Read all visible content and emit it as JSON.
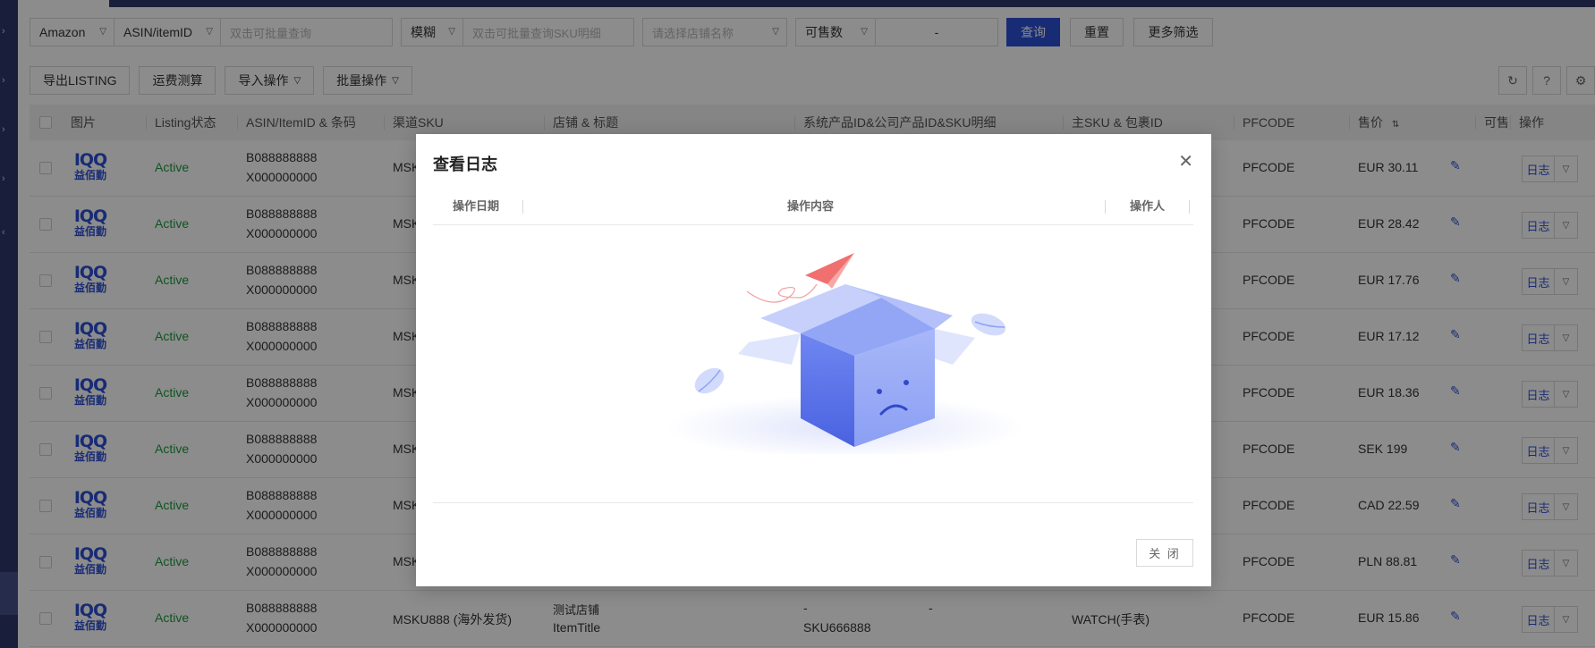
{
  "filters": {
    "platform": "Amazon",
    "id_type": "ASIN/itemID",
    "id_placeholder": "双击可批量查询",
    "match_mode": "模糊",
    "sku_placeholder": "双击可批量查询SKU明细",
    "shop_placeholder": "请选择店铺名称",
    "qty_type": "可售数",
    "range_sep": "-",
    "search_label": "查询",
    "reset_label": "重置",
    "more_label": "更多筛选"
  },
  "actions": {
    "export": "导出LISTING",
    "freight": "运费测算",
    "import": "导入操作",
    "batch": "批量操作"
  },
  "table": {
    "headers": {
      "image": "图片",
      "status": "Listing状态",
      "asin": "ASIN/ItemID & 条码",
      "channel_sku": "渠道SKU",
      "shop_title": "店铺 & 标题",
      "sys_id": "系统产品ID&公司产品ID&SKU明细",
      "main_sku": "主SKU & 包裹ID",
      "pfcode": "PFCODE",
      "price": "售价",
      "sellable": "可售",
      "ops": "操作"
    },
    "logo_top": "IQQ",
    "logo_bottom": "益佰勤",
    "rows": [
      {
        "status": "Active",
        "asin": "B088888888",
        "barcode": "X000000000",
        "sku": "MSK",
        "pfcode": "PFCODE",
        "price": "EUR 30.11",
        "log": "日志"
      },
      {
        "status": "Active",
        "asin": "B088888888",
        "barcode": "X000000000",
        "sku": "MSK",
        "pfcode": "PFCODE",
        "price": "EUR 28.42",
        "log": "日志"
      },
      {
        "status": "Active",
        "asin": "B088888888",
        "barcode": "X000000000",
        "sku": "MSK",
        "pfcode": "PFCODE",
        "price": "EUR 17.76",
        "log": "日志"
      },
      {
        "status": "Active",
        "asin": "B088888888",
        "barcode": "X000000000",
        "sku": "MSK",
        "pfcode": "PFCODE",
        "price": "EUR 17.12",
        "log": "日志"
      },
      {
        "status": "Active",
        "asin": "B088888888",
        "barcode": "X000000000",
        "sku": "MSK",
        "pfcode": "PFCODE",
        "price": "EUR 18.36",
        "log": "日志"
      },
      {
        "status": "Active",
        "asin": "B088888888",
        "barcode": "X000000000",
        "sku": "MSK",
        "pfcode": "PFCODE",
        "price": "SEK 199",
        "log": "日志"
      },
      {
        "status": "Active",
        "asin": "B088888888",
        "barcode": "X000000000",
        "sku": "MSK",
        "pfcode": "PFCODE",
        "price": "CAD 22.59",
        "log": "日志"
      },
      {
        "status": "Active",
        "asin": "B088888888",
        "barcode": "X000000000",
        "sku": "MSK",
        "pfcode": "PFCODE",
        "price": "PLN 88.81",
        "log": "日志"
      },
      {
        "status": "Active",
        "asin": "B088888888",
        "barcode": "X000000000",
        "sku": "MSKU888 (海外发货)",
        "shop": "测试店铺",
        "title": "ItemTitle",
        "sys_dash1": "-",
        "sys_dash2": "-",
        "sys_sku": "SKU666888",
        "main_sku": "WATCH(手表)",
        "pfcode": "PFCODE",
        "price": "EUR 15.86",
        "log": "日志"
      }
    ]
  },
  "modal": {
    "title": "查看日志",
    "col_date": "操作日期",
    "col_content": "操作内容",
    "col_operator": "操作人",
    "close_label": "关 闭"
  },
  "icons": {
    "close": "close-icon",
    "refresh": "refresh-icon",
    "help": "help-icon",
    "settings": "gear-icon",
    "edit": "pencil-icon",
    "sort": "sort-icon",
    "empty": "empty-box-illustration"
  },
  "colors": {
    "primary": "#2c4fd6",
    "nav": "#2e3a6b",
    "active": "#1a9b3b"
  }
}
